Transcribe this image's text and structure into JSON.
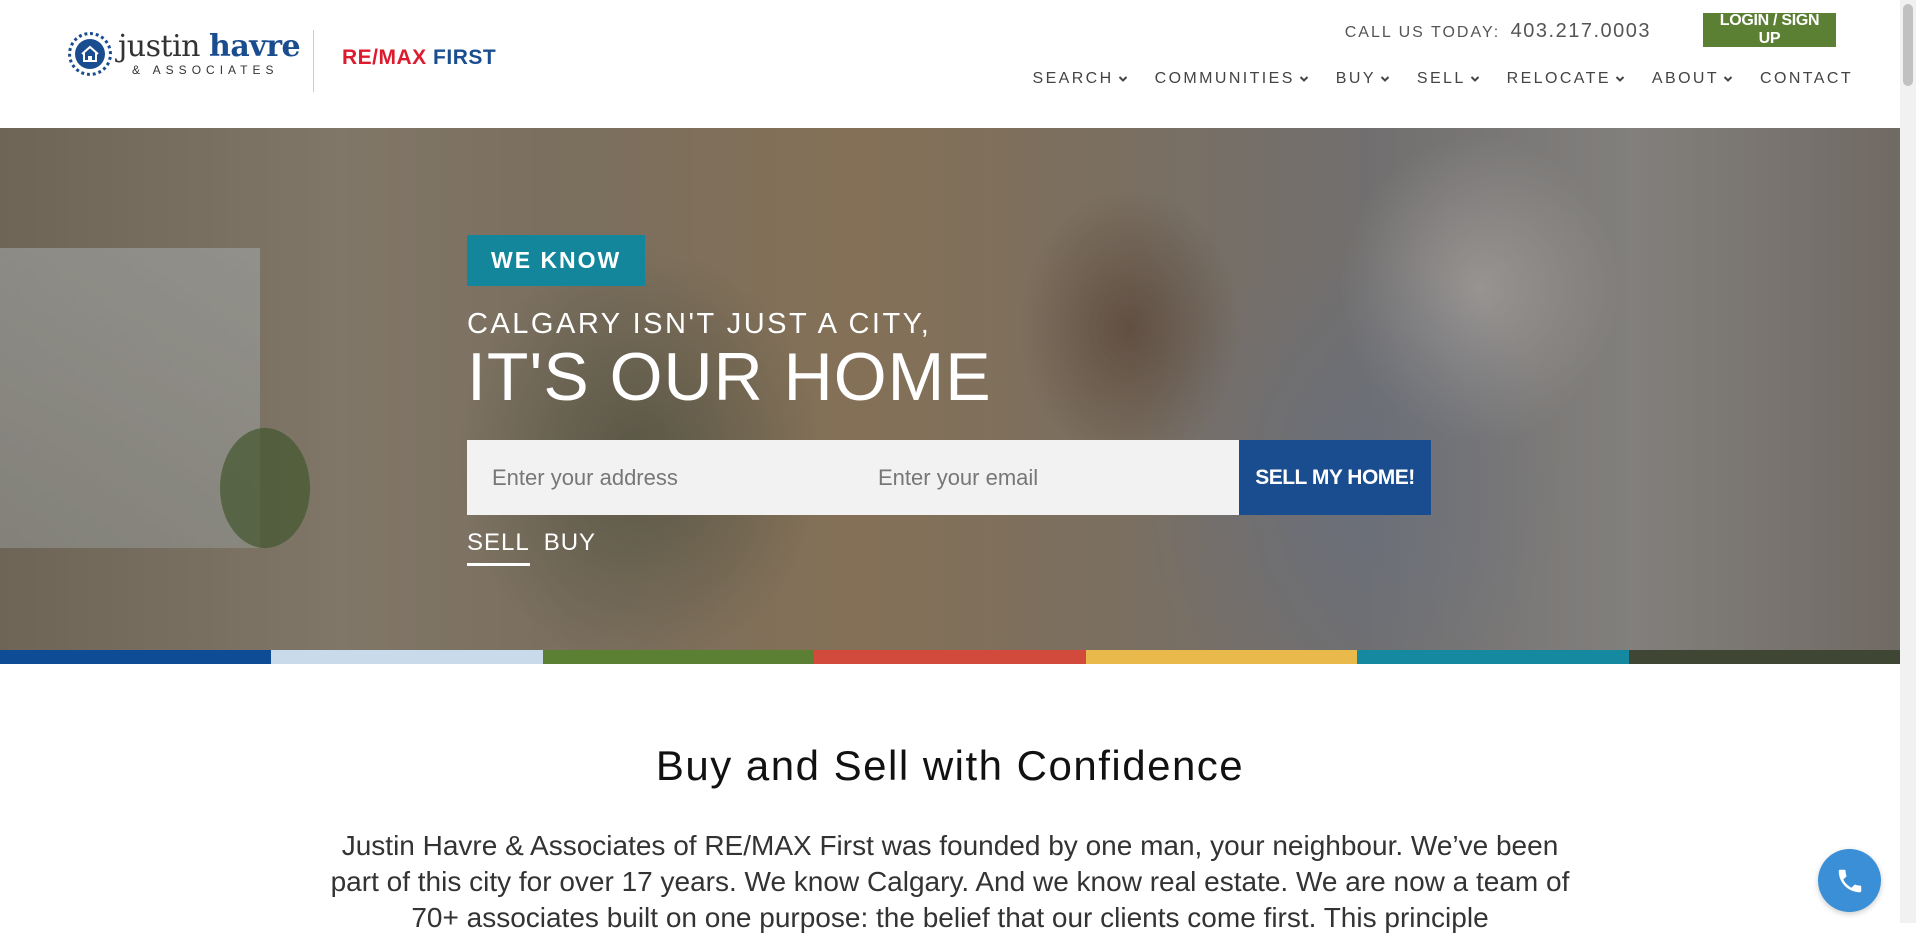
{
  "brand": {
    "name_first": "justin",
    "name_last": "havre",
    "associates": "& ASSOCIATES",
    "remax_re": "RE/MAX",
    "remax_first": "FIRST"
  },
  "topbar": {
    "call_label": "CALL US TODAY:",
    "phone": "403.217.0003",
    "login_label": "LOGIN / SIGN UP"
  },
  "nav": {
    "items": [
      {
        "label": "SEARCH",
        "dropdown": true
      },
      {
        "label": "COMMUNITIES",
        "dropdown": true
      },
      {
        "label": "BUY",
        "dropdown": true
      },
      {
        "label": "SELL",
        "dropdown": true
      },
      {
        "label": "RELOCATE",
        "dropdown": true
      },
      {
        "label": "ABOUT",
        "dropdown": true
      },
      {
        "label": "CONTACT",
        "dropdown": false
      }
    ]
  },
  "hero": {
    "badge": "WE KNOW",
    "line1": "CALGARY ISN'T JUST A CITY,",
    "line2": "IT'S OUR HOME",
    "address_placeholder": "Enter your address",
    "email_placeholder": "Enter your email",
    "submit_label": "SELL MY HOME!",
    "tabs": [
      "SELL",
      "BUY"
    ],
    "active_tab": "SELL"
  },
  "strip_colors": [
    "#0f4c96",
    "#c9dbea",
    "#5b7f33",
    "#d24a3c",
    "#eab94b",
    "#1489a0",
    "#3f4734"
  ],
  "content": {
    "title": "Buy and Sell with Confidence",
    "paragraph": "Justin Havre & Associates of RE/MAX First was founded by one man, your neighbour. We’ve been part of this city for over 17 years. We know Calgary. And we know real estate. We are now a team of 70+ associates built on one purpose: the belief that our clients come first. This principle"
  },
  "colors": {
    "brand_blue": "#1a4d8f",
    "login_green": "#5b7f33",
    "badge_teal": "#13869b",
    "remax_red": "#dc1c2e",
    "fab_blue": "#3a8fd6"
  },
  "icons": {
    "seal": "house-seal-icon",
    "chevron": "chevron-down-icon",
    "phone": "phone-icon"
  }
}
